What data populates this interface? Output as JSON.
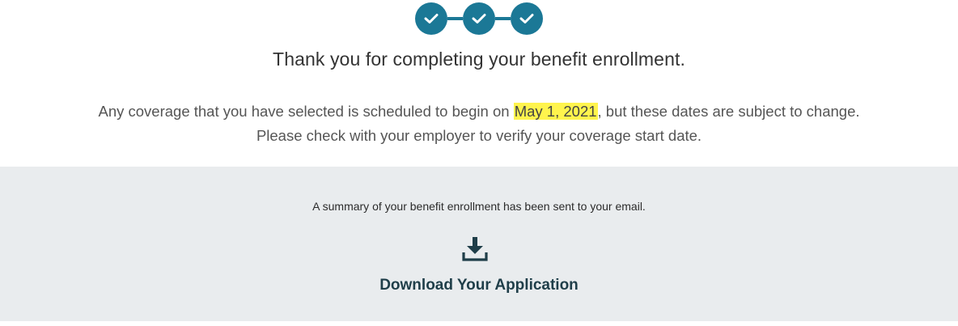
{
  "progress": {
    "steps": [
      {
        "status": "complete",
        "icon": "check-icon"
      },
      {
        "status": "complete",
        "icon": "check-icon"
      },
      {
        "status": "complete",
        "icon": "check-icon"
      }
    ],
    "color": "#1b7896"
  },
  "confirmation": {
    "title": "Thank you for completing your benefit enrollment.",
    "notice_before": "Any coverage that you have selected is scheduled to begin on ",
    "start_date": "May 1, 2021",
    "notice_after": ", but these dates are subject to change.",
    "notice_line2": "Please check with your employer to verify your coverage start date.",
    "highlight_color": "#fff44d"
  },
  "summary": {
    "email_note": "A summary of your benefit enrollment has been sent to your email.",
    "download_icon": "download-icon",
    "download_label": "Download Your Application"
  }
}
